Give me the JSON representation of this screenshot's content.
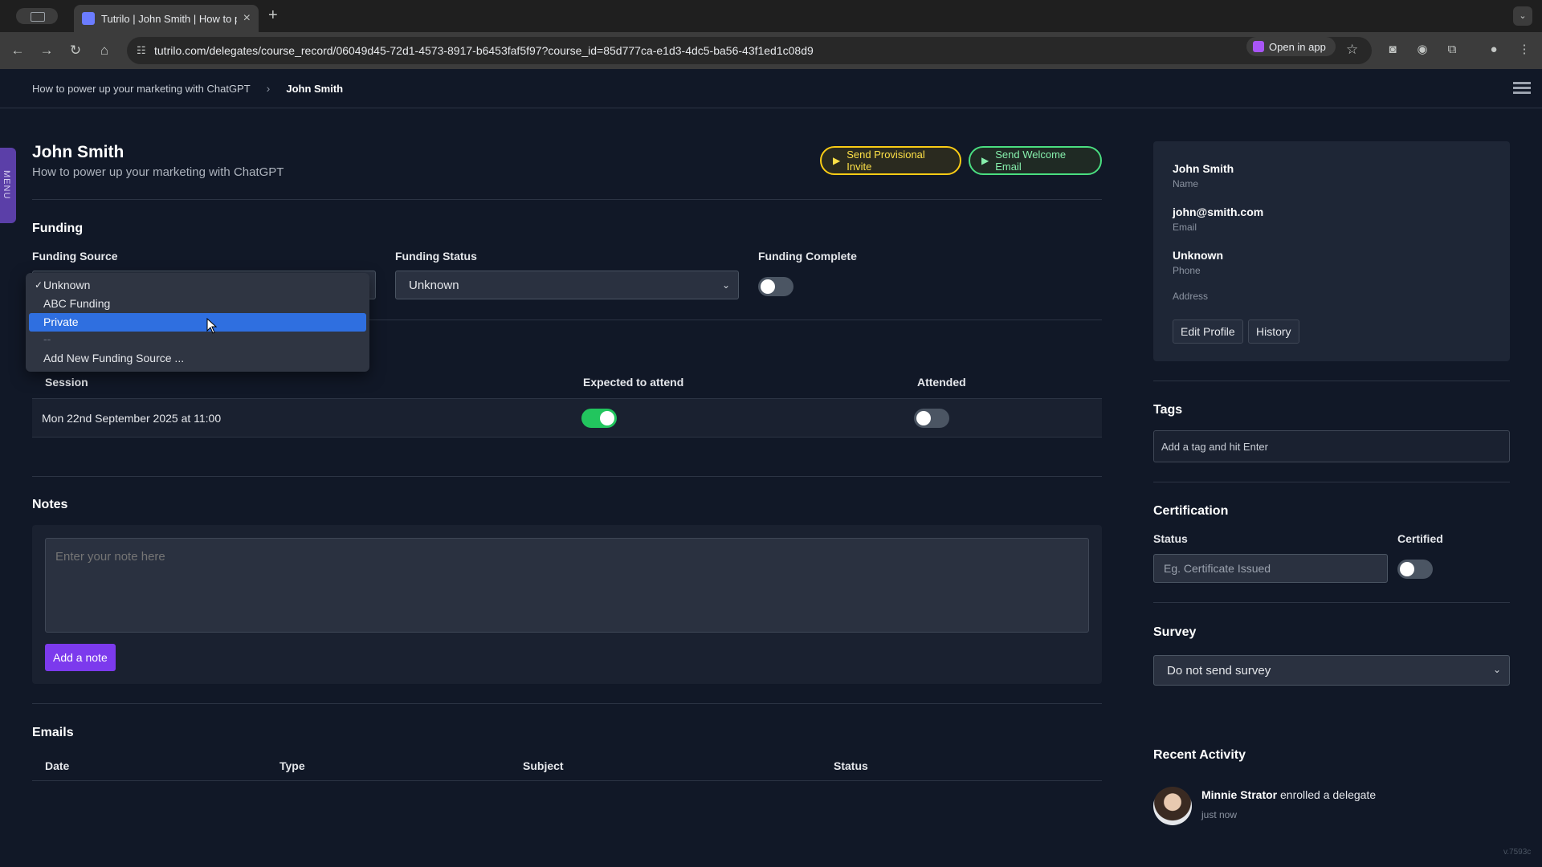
{
  "browser": {
    "tab_title": "Tutrilo | John Smith | How to p",
    "url": "tutrilo.com/delegates/course_record/06049d45-72d1-4573-8917-b6453faf5f97?course_id=85d777ca-e1d3-4dc5-ba56-43f1ed1c08d9",
    "open_in_app": "Open in app"
  },
  "breadcrumb": {
    "course": "How to power up your marketing with ChatGPT",
    "separator": "›",
    "current": "John Smith"
  },
  "side_menu": {
    "label": "MENU"
  },
  "header": {
    "title": "John Smith",
    "subtitle": "How to power up your marketing with ChatGPT",
    "provisional_invite": "Send Provisional Invite",
    "welcome_email": "Send Welcome Email"
  },
  "funding": {
    "title": "Funding",
    "source_label": "Funding Source",
    "status_label": "Funding Status",
    "status_value": "Unknown",
    "complete_label": "Funding Complete",
    "complete_on": false,
    "options": [
      "Unknown",
      "ABC Funding",
      "Private",
      "--",
      "Add New Funding Source ..."
    ],
    "selected_option": "Unknown",
    "highlighted_option": "Private"
  },
  "sessions": {
    "col_session": "Session",
    "col_expected": "Expected to attend",
    "col_attended": "Attended",
    "rows": [
      {
        "date": "Mon 22nd September 2025 at 11:00",
        "expected": true,
        "attended": false
      }
    ]
  },
  "notes": {
    "title": "Notes",
    "placeholder": "Enter your note here",
    "add_button": "Add a note"
  },
  "emails": {
    "title": "Emails",
    "col_date": "Date",
    "col_type": "Type",
    "col_subject": "Subject",
    "col_status": "Status"
  },
  "profile": {
    "name": "John Smith",
    "name_label": "Name",
    "email": "john@smith.com",
    "email_label": "Email",
    "phone": "Unknown",
    "phone_label": "Phone",
    "address_label": "Address",
    "edit_button": "Edit Profile",
    "history_button": "History"
  },
  "tags": {
    "title": "Tags",
    "placeholder": "Add a tag and hit Enter"
  },
  "certification": {
    "title": "Certification",
    "status_label": "Status",
    "status_placeholder": "Eg. Certificate Issued",
    "certified_label": "Certified",
    "certified_on": false
  },
  "survey": {
    "title": "Survey",
    "value": "Do not send survey"
  },
  "recent_activity": {
    "title": "Recent Activity",
    "items": [
      {
        "user": "Minnie Strator",
        "action": "enrolled a delegate",
        "time": "just now"
      }
    ]
  },
  "version": "v.7593c",
  "colors": {
    "background": "#111827",
    "accent_purple": "#7c3aed",
    "toggle_on": "#22c55e",
    "highlight_blue": "#2f6fe0"
  }
}
